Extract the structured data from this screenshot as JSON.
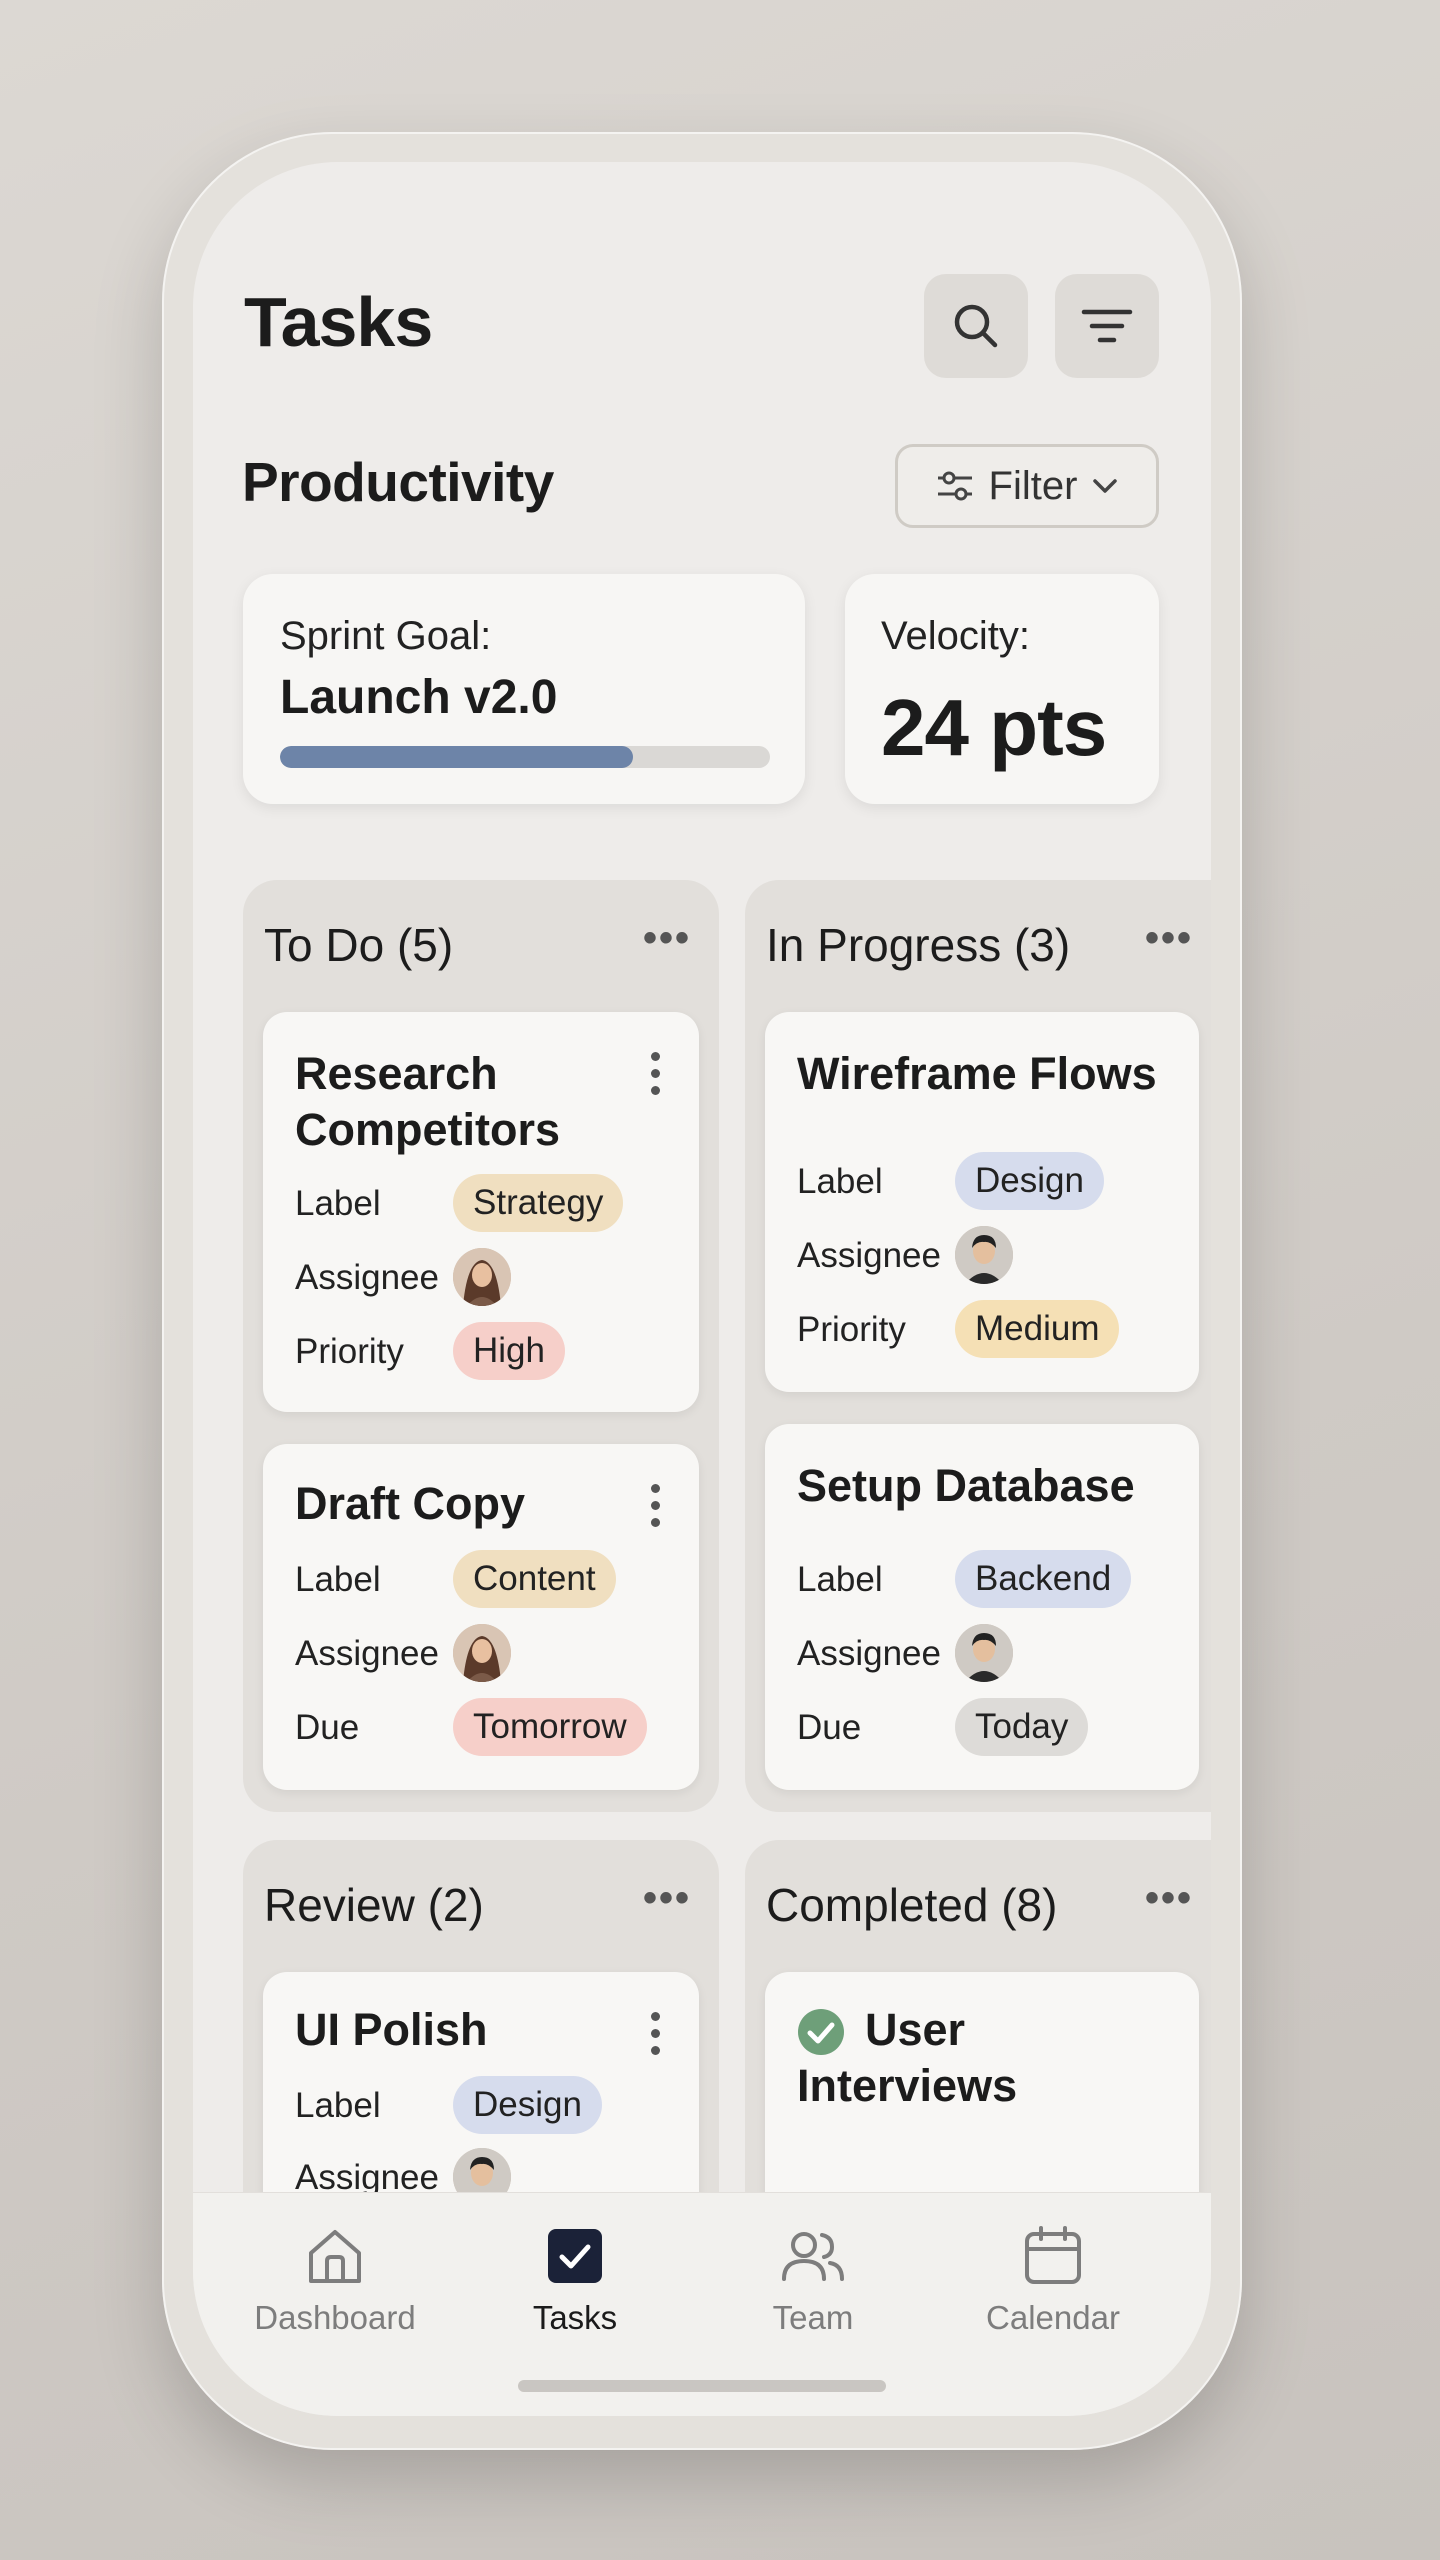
{
  "header": {
    "title": "Tasks"
  },
  "section": {
    "title": "Productivity",
    "filter_label": "Filter"
  },
  "stats": {
    "sprint_label": "Sprint Goal:",
    "sprint_value": "Launch v2.0",
    "sprint_progress": 0.72,
    "velocity_label": "Velocity:",
    "velocity_value": "24 pts"
  },
  "columns": [
    {
      "title": "To Do (5)",
      "cards": [
        {
          "title": "Research Competitors",
          "rows": [
            {
              "label": "Label",
              "value": "Strategy",
              "color": "#f0dfc0"
            },
            {
              "label": "Assignee",
              "avatar": "woman-avatar"
            },
            {
              "label": "Priority",
              "value": "High",
              "color": "#f6cfc9"
            }
          ]
        },
        {
          "title": "Draft Copy",
          "rows": [
            {
              "label": "Label",
              "value": "Content",
              "color": "#f0dfc0"
            },
            {
              "label": "Assignee",
              "avatar": "woman-avatar"
            },
            {
              "label": "Due",
              "value": "Tomorrow",
              "color": "#f6cfc9"
            }
          ]
        }
      ]
    },
    {
      "title": "In Progress (3)",
      "cards": [
        {
          "title": "Wireframe Flows",
          "rows": [
            {
              "label": "Label",
              "value": "Design",
              "color": "#d6dced"
            },
            {
              "label": "Assignee",
              "avatar": "man-avatar"
            },
            {
              "label": "Priority",
              "value": "Medium",
              "color": "#f5e0b5"
            }
          ]
        },
        {
          "title": "Setup Database",
          "rows": [
            {
              "label": "Label",
              "value": "Backend",
              "color": "#d6dced"
            },
            {
              "label": "Assignee",
              "avatar": "man-avatar"
            },
            {
              "label": "Due",
              "value": "Today",
              "color": "#dddbd8"
            }
          ]
        }
      ]
    },
    {
      "title": "Review (2)",
      "cards": [
        {
          "title": "UI Polish",
          "rows": [
            {
              "label": "Label",
              "value": "Design",
              "color": "#d6dced"
            },
            {
              "label": "Assignee",
              "avatar": "man-avatar"
            }
          ]
        }
      ]
    },
    {
      "title": "Completed (8)",
      "cards": [
        {
          "title_line1": "User",
          "title_line2": "Interviews",
          "check_color": "#6e9f79"
        }
      ]
    }
  ],
  "nav": [
    {
      "label": "Dashboard",
      "icon": "home-icon",
      "active": false
    },
    {
      "label": "Tasks",
      "icon": "checkbox-icon",
      "active": true
    },
    {
      "label": "Team",
      "icon": "users-icon",
      "active": false
    },
    {
      "label": "Calendar",
      "icon": "calendar-icon",
      "active": false
    }
  ],
  "colors": {
    "accent": "#6d84a8",
    "active_nav": "#1b2238",
    "completed_check": "#6e9f79"
  }
}
